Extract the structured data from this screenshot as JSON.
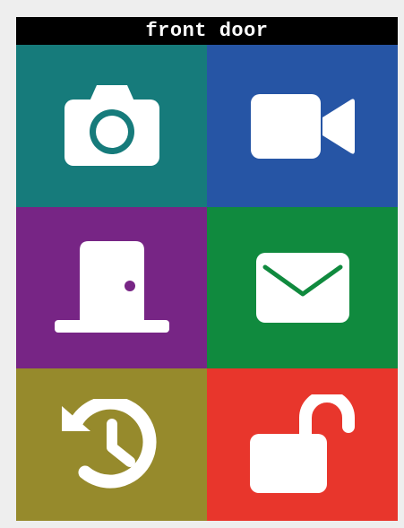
{
  "title": "front door",
  "colors": {
    "camera": "#167b7b",
    "video": "#2655a5",
    "door": "#772585",
    "message": "#108a3e",
    "history": "#968a2c",
    "unlock": "#e8362c",
    "icon": "#ffffff",
    "title_bg": "#000000",
    "title_text": "#ffffff"
  },
  "tiles": [
    {
      "icon": "camera-icon"
    },
    {
      "icon": "video-camera-icon"
    },
    {
      "icon": "door-icon"
    },
    {
      "icon": "envelope-icon"
    },
    {
      "icon": "history-icon"
    },
    {
      "icon": "unlocked-padlock-icon"
    }
  ]
}
